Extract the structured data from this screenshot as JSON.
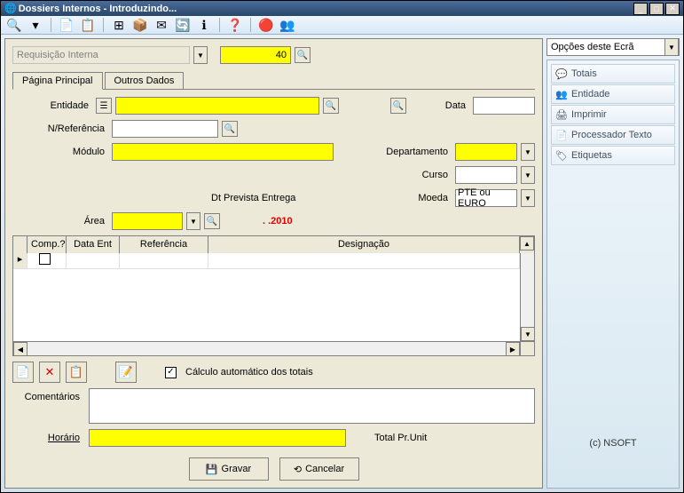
{
  "window": {
    "title": "Dossiers Internos - Introduzindo..."
  },
  "toolbar_icons": [
    "🔍",
    "▾",
    "📄",
    "📋",
    "⊞",
    "📦",
    "✉",
    "🔄",
    "ℹ",
    "❓",
    "",
    "🔴",
    "👥"
  ],
  "top": {
    "combo_label": "Requisição Interna",
    "number": "40"
  },
  "tabs": [
    {
      "label": "Página Principal",
      "active": true
    },
    {
      "label": "Outros Dados",
      "active": false
    }
  ],
  "form": {
    "entidade_label": "Entidade",
    "nref_label": "N/Referência",
    "modulo_label": "Módulo",
    "data_label": "Data",
    "departamento_label": "Departamento",
    "curso_label": "Curso",
    "moeda_label": "Moeda",
    "moeda_value": "PTE ou EURO",
    "dtprevista_label": "Dt Prevista Entrega",
    "dtprevista_value": ".   .2010",
    "area_label": "Área"
  },
  "table": {
    "columns": [
      "Comp.?",
      "Data Ent",
      "Referência",
      "Designação"
    ]
  },
  "auto_totals_label": "Cálculo automático dos totais",
  "auto_totals_checked": "✓",
  "comments_label": "Comentários",
  "horario_label": "Horário",
  "total_pr_label": "Total Pr.Unit",
  "buttons": {
    "save": "Gravar",
    "cancel": "Cancelar"
  },
  "right": {
    "combo": "Opções deste Ecrã",
    "items": [
      {
        "icon": "💬",
        "label": "Totais"
      },
      {
        "icon": "👥",
        "label": "Entidade"
      },
      {
        "icon": "🖨",
        "label": "Imprimir"
      },
      {
        "icon": "📄",
        "label": "Processador Texto"
      },
      {
        "icon": "🏷",
        "label": "Etiquetas"
      }
    ],
    "copyright": "(c) NSOFT"
  }
}
